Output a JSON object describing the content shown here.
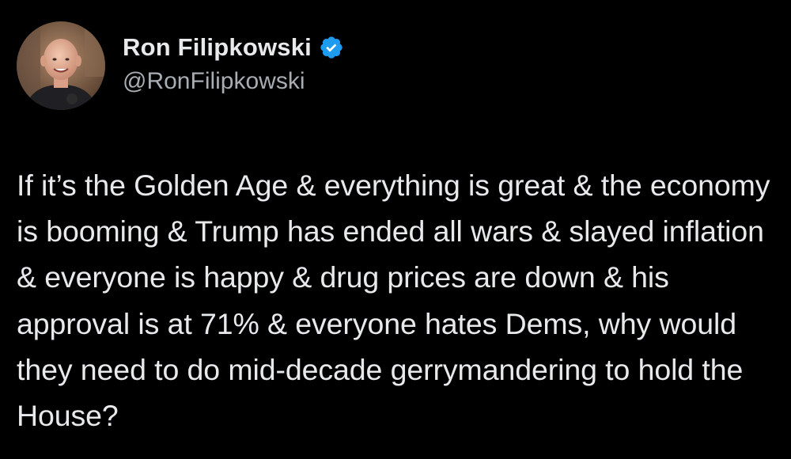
{
  "author": {
    "display_name": "Ron Filipkowski",
    "handle": "@RonFilipkowski",
    "verified": true,
    "avatar_icon": "profile-photo-icon",
    "verified_icon": "verified-badge-icon"
  },
  "tweet": {
    "text": "If it’s the Golden Age & everything is great & the economy is booming & Trump has ended all wars & slayed inflation & everyone is happy & drug prices are down & his approval is at 71% & everyone hates Dems, why would they need to do mid-decade gerrymandering to hold the House?"
  },
  "colors": {
    "background": "#000000",
    "text": "#e7e9ea",
    "secondary_text": "#a7adb2",
    "verified_blue": "#1d9bf0"
  }
}
